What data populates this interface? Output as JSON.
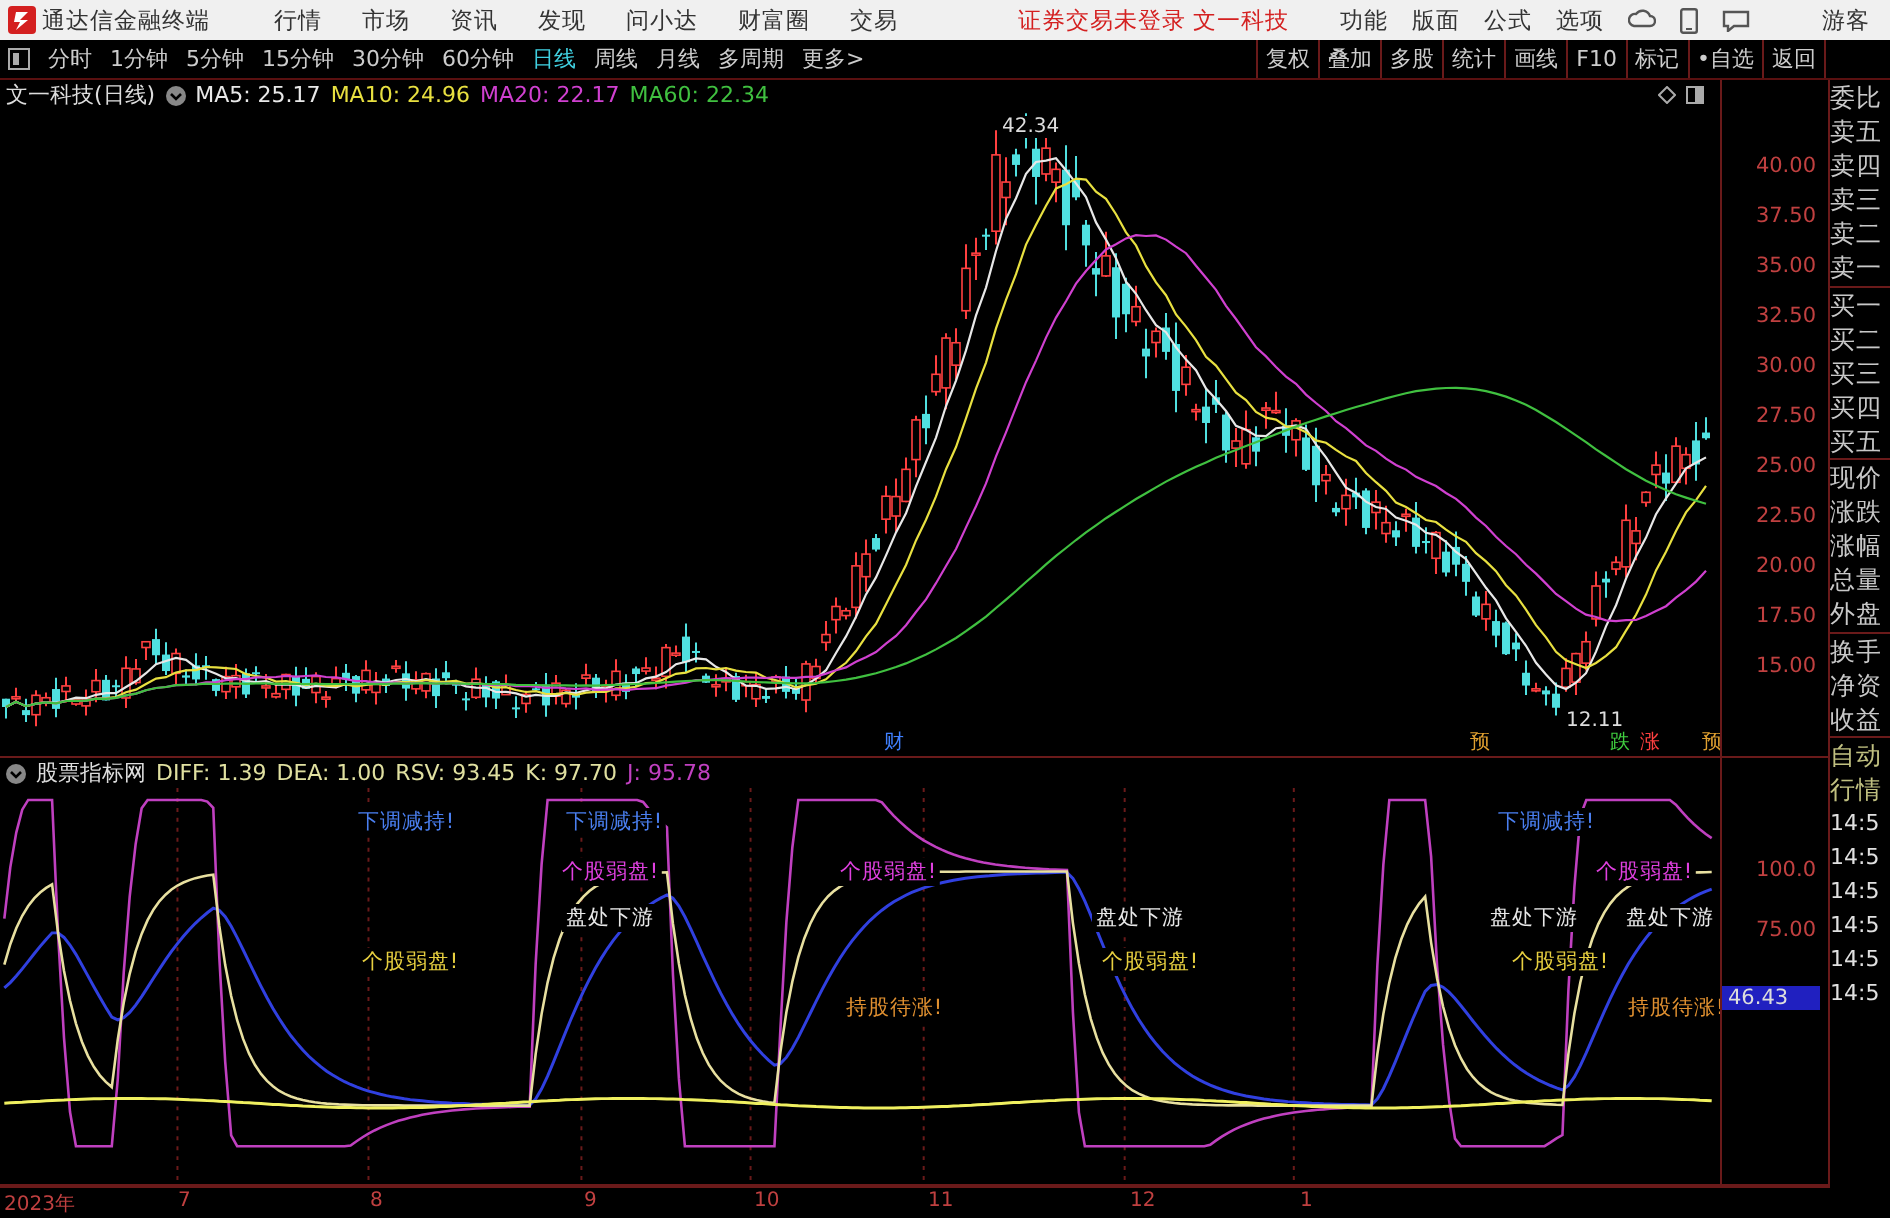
{
  "title_bar": {
    "app_name": "通达信金融终端",
    "menu": [
      "行情",
      "市场",
      "资讯",
      "发现",
      "问小达",
      "财富圈",
      "交易"
    ],
    "notice": "证券交易未登录 文一科技",
    "tools": [
      "功能",
      "版面",
      "公式",
      "选项"
    ],
    "user": "游客"
  },
  "period_tabs": [
    {
      "label": "分时",
      "selected": false
    },
    {
      "label": "1分钟",
      "selected": false
    },
    {
      "label": "5分钟",
      "selected": false
    },
    {
      "label": "15分钟",
      "selected": false
    },
    {
      "label": "30分钟",
      "selected": false
    },
    {
      "label": "60分钟",
      "selected": false
    },
    {
      "label": "日线",
      "selected": true
    },
    {
      "label": "周线",
      "selected": false
    },
    {
      "label": "月线",
      "selected": false
    },
    {
      "label": "多周期",
      "selected": false
    },
    {
      "label": "更多>",
      "selected": false
    }
  ],
  "chart_tools": [
    "复权",
    "叠加",
    "多股",
    "统计",
    "画线",
    "F10",
    "标记",
    "•自选",
    "返回"
  ],
  "price_chart": {
    "stock": "文一科技(日线)",
    "ma_legend": [
      {
        "label": "MA5: 25.17",
        "color": "#e8e8e8"
      },
      {
        "label": "MA10: 24.96",
        "color": "#e8e040"
      },
      {
        "label": "MA20: 22.17",
        "color": "#d040d0"
      },
      {
        "label": "MA60: 22.34",
        "color": "#40c040"
      }
    ],
    "y_ticks": [
      "40.00",
      "37.50",
      "35.00",
      "32.50",
      "30.00",
      "27.50",
      "25.00",
      "22.50",
      "20.00",
      "17.50",
      "15.00"
    ],
    "high_label": "42.34",
    "low_label": "12.11",
    "event_marks": [
      {
        "label": "财",
        "color": "#4080ff"
      },
      {
        "label": "预",
        "color": "#e0a030"
      },
      {
        "label": "跌",
        "color": "#40d040"
      },
      {
        "label": "涨",
        "color": "#ff4040"
      },
      {
        "label": "预",
        "color": "#e0a030"
      }
    ]
  },
  "indicator": {
    "name": "股票指标网",
    "values": [
      {
        "label": "DIFF: 1.39",
        "color": "#e0e0a0"
      },
      {
        "label": "DEA: 1.00",
        "color": "#e0e0a0"
      },
      {
        "label": "RSV: 93.45",
        "color": "#e0e0a0"
      },
      {
        "label": "K: 97.70",
        "color": "#e0e0a0"
      },
      {
        "label": "J: 95.78",
        "color": "#c040c0"
      }
    ],
    "signals": [
      {
        "text": "下调减持!",
        "color": "#4a7ff0"
      },
      {
        "text": "下调减持!",
        "color": "#4a7ff0"
      },
      {
        "text": "下调减持!",
        "color": "#4a7ff0"
      },
      {
        "text": "个股弱盘!",
        "color": "#e040e0"
      },
      {
        "text": "个股弱盘!",
        "color": "#e040e0"
      },
      {
        "text": "个股弱盘!",
        "color": "#e040e0"
      },
      {
        "text": "盘处下游",
        "color": "#e8e8e8"
      },
      {
        "text": "盘处下游",
        "color": "#e8e8e8"
      },
      {
        "text": "盘处下游",
        "color": "#e8e8e8"
      },
      {
        "text": "盘处下游",
        "color": "#e8e8e8"
      },
      {
        "text": "个股弱盘!",
        "color": "#e8d040"
      },
      {
        "text": "个股弱盘!",
        "color": "#e8d040"
      },
      {
        "text": "个股弱盘!",
        "color": "#e8d040"
      },
      {
        "text": "持股待涨!",
        "color": "#e09030"
      },
      {
        "text": "持股待涨!",
        "color": "#e09030"
      }
    ],
    "y_ticks": [
      "100.0",
      "75.00"
    ],
    "current_value": "46.43"
  },
  "time_axis": [
    "2023年",
    "7",
    "8",
    "9",
    "10",
    "11",
    "12",
    "1"
  ],
  "side_panel": {
    "quote_labels": [
      "委比",
      "卖五",
      "卖四",
      "卖三",
      "卖二",
      "卖一",
      "买一",
      "买二",
      "买三",
      "买四",
      "买五",
      "现价",
      "涨跌",
      "涨幅",
      "总量",
      "外盘",
      "换手",
      "净资",
      "收益"
    ],
    "mode_labels": [
      "自动",
      "行情"
    ],
    "times": [
      "14:5",
      "14:5",
      "14:5",
      "14:5",
      "14:5",
      "14:5"
    ]
  }
}
